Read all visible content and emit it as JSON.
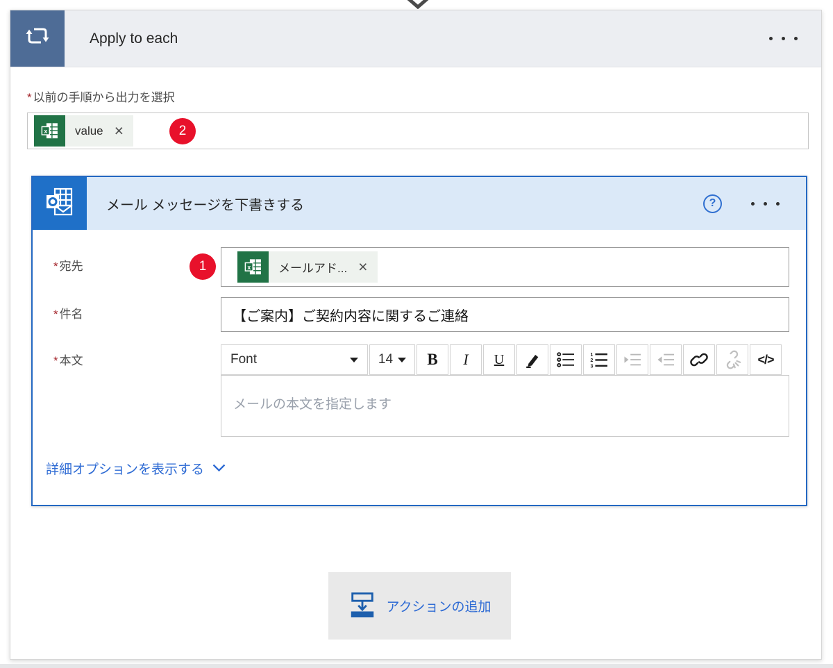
{
  "ui": {
    "required_mark": "*"
  },
  "apply_to_each": {
    "title": "Apply to each",
    "select_output_label": "以前の手順から出力を選択",
    "value_token": {
      "label": "value",
      "icon": "excel-icon",
      "remove": "×"
    },
    "callout_badge": "2"
  },
  "draft_email": {
    "title": "メール メッセージを下書きする",
    "help_label": "?",
    "to": {
      "label": "宛先",
      "token_label": "メールアド...",
      "remove": "×",
      "callout_badge": "1"
    },
    "subject": {
      "label": "件名",
      "value": "【ご案内】ご契約内容に関するご連絡"
    },
    "body": {
      "label": "本文",
      "placeholder": "メールの本文を指定します"
    },
    "toolbar": {
      "font": "Font",
      "size": "14",
      "bold": "B",
      "italic": "I",
      "underline": "U",
      "code": "</>"
    },
    "advanced_label": "詳細オプションを表示する"
  },
  "add_action": {
    "label": "アクションの追加"
  },
  "colors": {
    "scope_slate": "#4e6c96",
    "scope_header": "#eceef2",
    "action_border": "#2468c2",
    "action_header": "#dbe9f8",
    "outlook_blue": "#1f70c8",
    "excel_green": "#217346",
    "token_bg": "#eef2ee",
    "callout_red": "#e8112b",
    "link_blue": "#2e6bd4",
    "add_action_bg": "#e9e9e9"
  }
}
